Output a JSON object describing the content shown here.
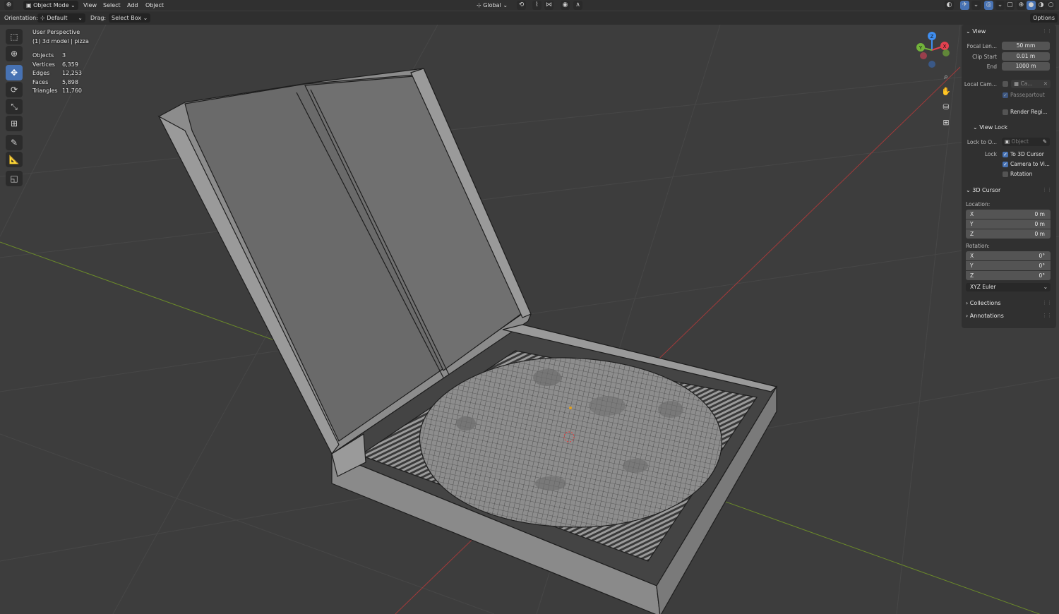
{
  "header": {
    "mode": "Object Mode",
    "menus": [
      "View",
      "Select",
      "Add",
      "Object"
    ],
    "transform_orientation": "Global"
  },
  "toolbar": {
    "orientation_label": "Orientation:",
    "orientation_value": "Default",
    "drag_label": "Drag:",
    "drag_value": "Select Box",
    "options": "Options"
  },
  "viewport": {
    "view_name": "User Perspective",
    "collection": "(1) 3d model | pizza",
    "stats": [
      {
        "label": "Objects",
        "value": "3"
      },
      {
        "label": "Vertices",
        "value": "6,359"
      },
      {
        "label": "Edges",
        "value": "12,253"
      },
      {
        "label": "Faces",
        "value": "5,898"
      },
      {
        "label": "Triangles",
        "value": "11,760"
      }
    ],
    "gizmo": {
      "x": "X",
      "y": "Y",
      "z": "Z",
      "x_color": "#e2414f",
      "y_color": "#72b33a",
      "z_color": "#3f8ef0"
    }
  },
  "sidebar": {
    "view": {
      "title": "View",
      "focal_length_label": "Focal Len...",
      "focal_length": "50 mm",
      "clip_start_label": "Clip Start",
      "clip_start": "0.01 m",
      "clip_end_label": "End",
      "clip_end": "1000 m",
      "local_camera_label": "Local Cam...",
      "local_camera_value": "Ca...",
      "passepartout": "Passepartout",
      "render_region": "Render Regi..."
    },
    "view_lock": {
      "title": "View Lock",
      "lock_to_object_label": "Lock to O...",
      "lock_to_object_placeholder": "Object",
      "lock_label": "Lock",
      "to_3d_cursor": "To 3D Cursor",
      "camera_to_view": "Camera to Vi...",
      "rotation": "Rotation"
    },
    "cursor": {
      "title": "3D Cursor",
      "location_label": "Location:",
      "location": [
        {
          "axis": "X",
          "value": "0 m"
        },
        {
          "axis": "Y",
          "value": "0 m"
        },
        {
          "axis": "Z",
          "value": "0 m"
        }
      ],
      "rotation_label": "Rotation:",
      "rotation": [
        {
          "axis": "X",
          "value": "0°"
        },
        {
          "axis": "Y",
          "value": "0°"
        },
        {
          "axis": "Z",
          "value": "0°"
        }
      ],
      "rotation_mode": "XYZ Euler"
    },
    "collections": "Collections",
    "annotations": "Annotations"
  },
  "colors": {
    "accent": "#4772b3",
    "x_axis_line": "#a23a3a",
    "y_axis_line": "#6b8a2a"
  }
}
